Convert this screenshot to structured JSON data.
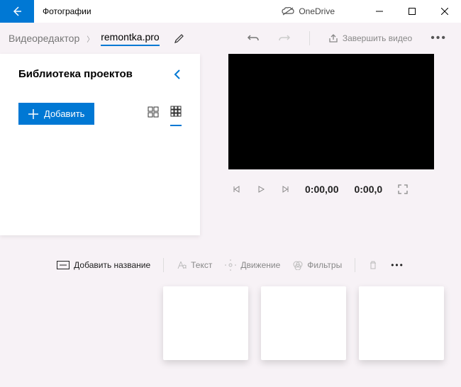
{
  "titlebar": {
    "app_name": "Фотографии",
    "onedrive": "OneDrive"
  },
  "breadcrumb": {
    "root": "Видеоредактор",
    "project": "remontka.pro"
  },
  "toolbar": {
    "finish_label": "Завершить видео"
  },
  "library": {
    "title": "Библиотека проектов",
    "add_label": "Добавить"
  },
  "player": {
    "time_current": "0:00,00",
    "time_total": "0:00,0"
  },
  "clipbar": {
    "add_title": "Добавить название",
    "text": "Текст",
    "motion": "Движение",
    "filters": "Фильтры"
  }
}
